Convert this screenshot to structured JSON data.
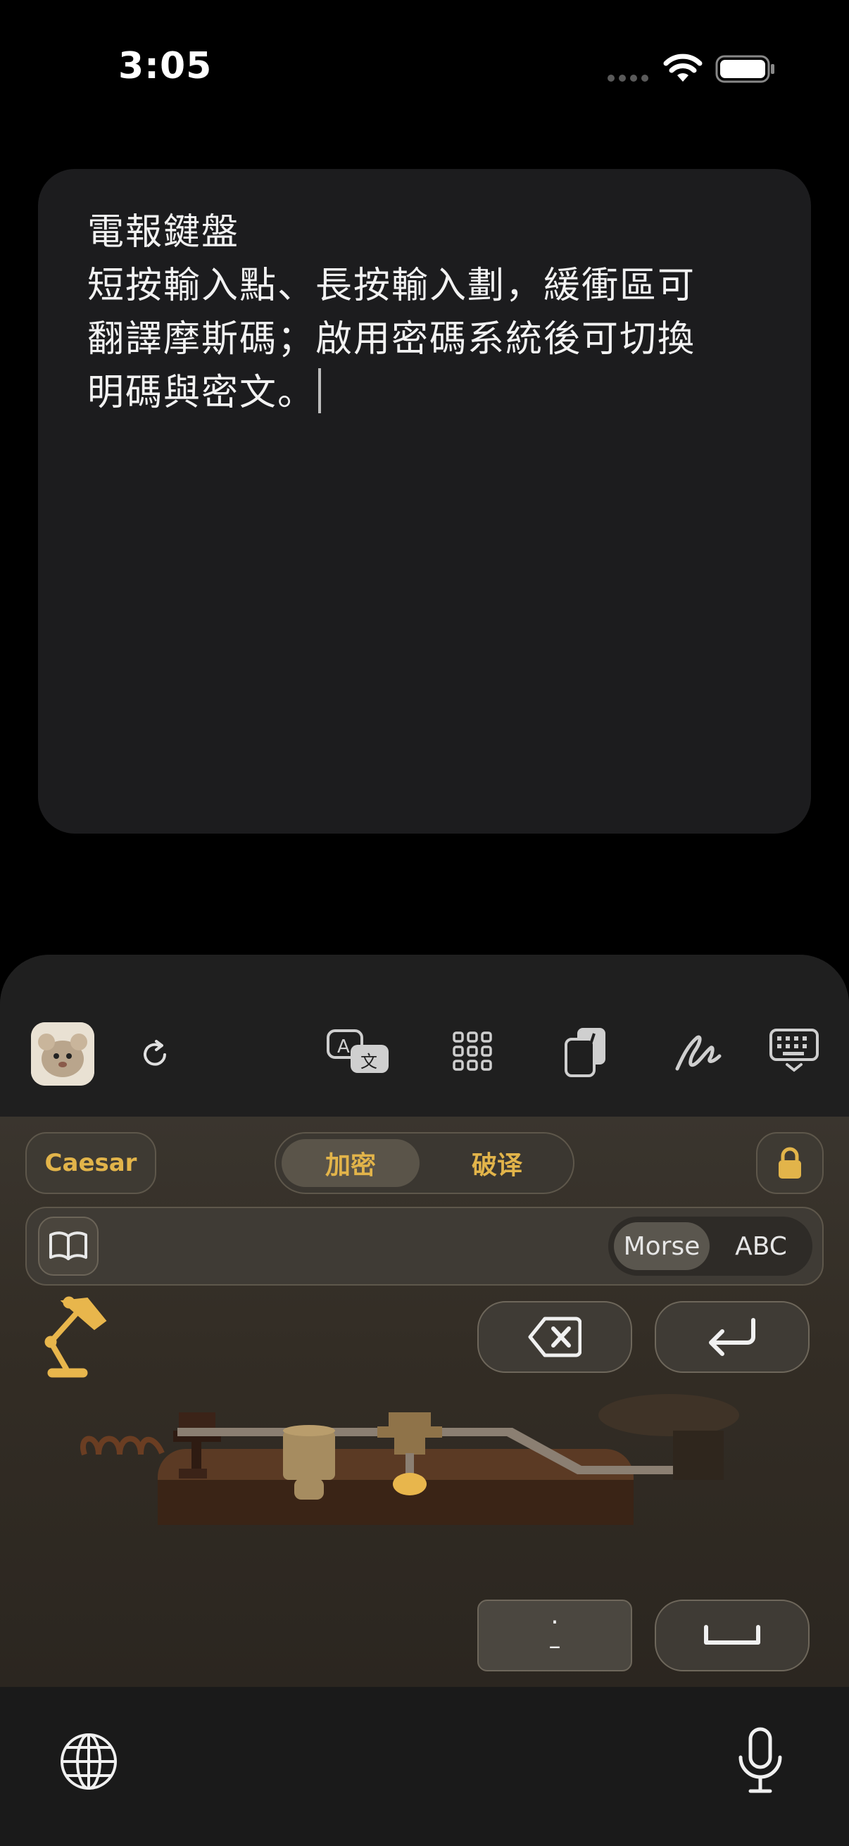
{
  "status_bar": {
    "time": "3:05"
  },
  "note": {
    "title": "電報鍵盤",
    "line1": "短按輸入點、長按輸入劃，緩衝區可",
    "line2": "翻譯摩斯碼；啟用密碼系統後可切換",
    "line3": "明碼與密文。"
  },
  "toolbar": {
    "icons": [
      "app-icon",
      "refresh-icon",
      "translate-icon",
      "grid-icon",
      "clipboard-icon",
      "handwriting-icon",
      "keyboard-hide-icon"
    ]
  },
  "cipher": {
    "caesar_label": "Caesar",
    "encrypt_label": "加密",
    "decrypt_label": "破译"
  },
  "buffer": {
    "mode_morse": "Morse",
    "mode_abc": "ABC"
  },
  "keys": {
    "dot_dash_top": "·",
    "dot_dash_bottom": "–"
  },
  "colors": {
    "accent": "#e2b44a",
    "panel": "#3a352e",
    "background": "#000000"
  }
}
